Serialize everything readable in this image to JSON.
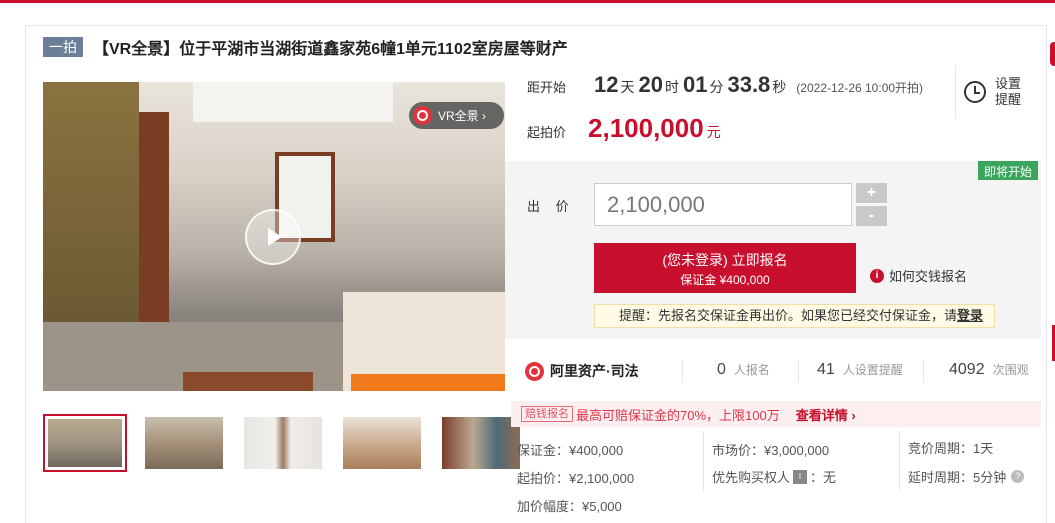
{
  "title": {
    "badge": "一拍",
    "text": "【VR全景】位于平湖市当湖街道鑫家苑6幢1单元1102室房屋等财产"
  },
  "gallery": {
    "vr_label": "VR全景 ›",
    "thumbnail_count": 5
  },
  "timer": {
    "label": "距开始",
    "days": "12",
    "days_unit": "天",
    "hours": "20",
    "hours_unit": "时",
    "minutes": "01",
    "minutes_unit": "分",
    "seconds": "33.8",
    "seconds_unit": "秒",
    "start_at": "(2022-12-26 10:00开拍)",
    "remind_label": "设置提醒"
  },
  "start_price": {
    "label": "起拍价",
    "value": "2,100,000",
    "unit": "元"
  },
  "bid": {
    "status_tag": "即将开始",
    "label": "出 价",
    "input_value": "2,100,000",
    "plus": "+",
    "minus": "-",
    "register_line1": "(您未登录) 立即报名",
    "register_line2": "保证金 ¥400,000",
    "howto": "如何交钱报名",
    "tip_prefix": "提醒：先报名交保证金再出价。如果您已经交付保证金，请",
    "tip_link": "登录"
  },
  "stats": {
    "brand": "阿里资产·司法",
    "registrants": "0",
    "registrants_label": "人报名",
    "reminders": "41",
    "reminders_label": "人设置提醒",
    "views": "4092",
    "views_label": "次围观"
  },
  "promo": {
    "tag": "赔钱报名",
    "text": "最高可赔保证金的70%，上限100万",
    "link": "查看详情 ›"
  },
  "details": {
    "deposit": "保证金：¥400,000",
    "start_price": "起拍价：¥2,100,000",
    "increment": "加价幅度：¥5,000",
    "market_price": "市场价：¥3,000,000",
    "priority_label": "优先购买权人",
    "priority_value": "：无",
    "priority_icon_text": "Ι",
    "cycle": "竞价周期：1天",
    "delay": "延时周期：5分钟",
    "help_icon": "?"
  }
}
